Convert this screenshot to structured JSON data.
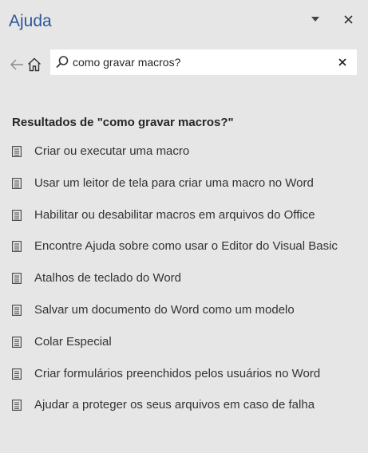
{
  "pane": {
    "title": "Ajuda"
  },
  "search": {
    "value": "como gravar macros?",
    "placeholder": ""
  },
  "results": {
    "heading": "Resultados de \"como gravar macros?\"",
    "items": [
      {
        "label": "Criar ou executar uma macro"
      },
      {
        "label": "Usar um leitor de tela para criar uma macro no Word"
      },
      {
        "label": "Habilitar ou desabilitar macros em arquivos do Office"
      },
      {
        "label": "Encontre Ajuda sobre como usar o Editor do Visual Basic"
      },
      {
        "label": "Atalhos de teclado do Word"
      },
      {
        "label": "Salvar um documento do Word como um modelo"
      },
      {
        "label": "Colar Especial"
      },
      {
        "label": "Criar formulários preenchidos pelos usuários no Word"
      },
      {
        "label": "Ajudar a proteger os seus arquivos em caso de falha"
      }
    ]
  },
  "icons": {
    "dropdown": "chevron-down-icon",
    "close": "close-icon",
    "back": "arrow-left-icon",
    "home": "home-icon",
    "search": "search-icon",
    "clear": "clear-icon",
    "result": "document-icon"
  },
  "colors": {
    "background": "#e6e6e6",
    "title": "#2b579a",
    "search_background": "#ffffff",
    "text": "#262626"
  }
}
